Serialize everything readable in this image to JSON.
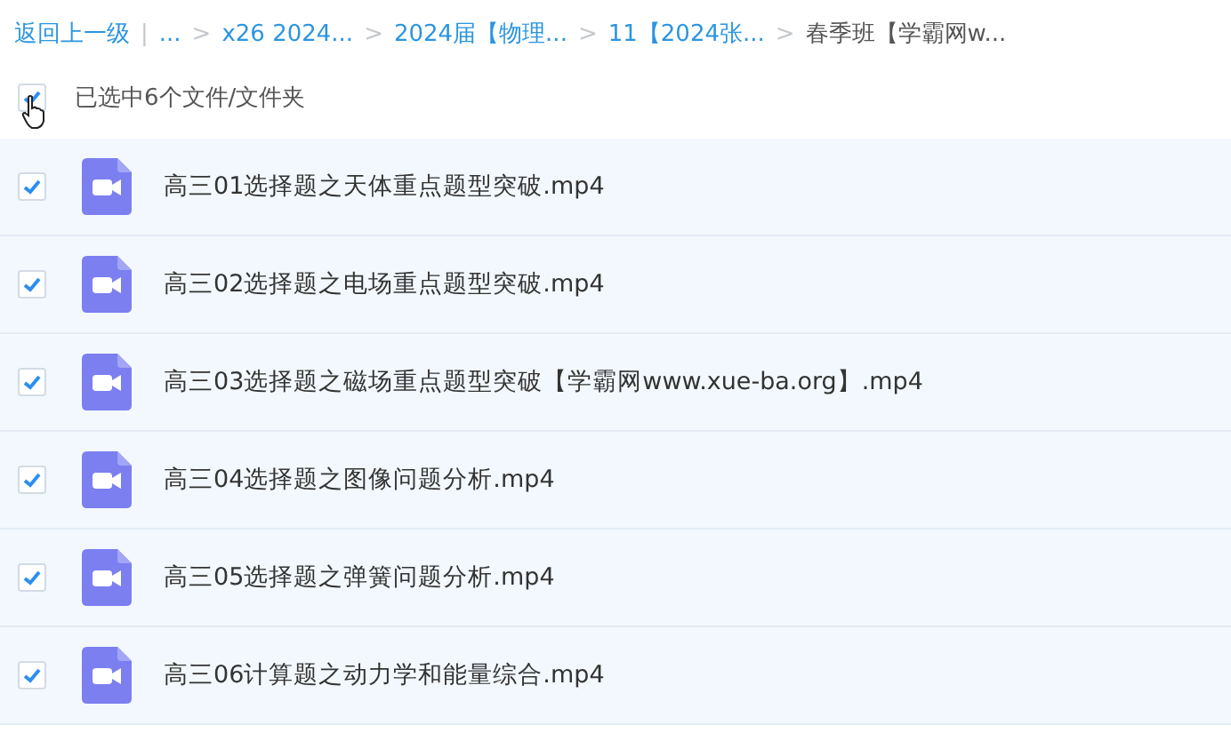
{
  "breadcrumb": [
    {
      "label": "返回上一级",
      "kind": "link"
    },
    {
      "label": "|",
      "kind": "separator"
    },
    {
      "label": "...",
      "kind": "link"
    },
    {
      "label": ">",
      "kind": "separator"
    },
    {
      "label": "x26 2024...",
      "kind": "link"
    },
    {
      "label": ">",
      "kind": "separator"
    },
    {
      "label": "2024届【物理...",
      "kind": "link"
    },
    {
      "label": ">",
      "kind": "separator"
    },
    {
      "label": "11【2024张...",
      "kind": "link"
    },
    {
      "label": ">",
      "kind": "separator"
    },
    {
      "label": "春季班【学霸网w...",
      "kind": "current"
    }
  ],
  "select_all": {
    "label": "已选中6个文件/文件夹",
    "checked": true
  },
  "files": [
    {
      "name": "高三01选择题之天体重点题型突破.mp4",
      "checked": true
    },
    {
      "name": "高三02选择题之电场重点题型突破.mp4",
      "checked": true
    },
    {
      "name": "高三03选择题之磁场重点题型突破【学霸网www.xue-ba.org】.mp4",
      "checked": true
    },
    {
      "name": "高三04选择题之图像问题分析.mp4",
      "checked": true
    },
    {
      "name": "高三05选择题之弹簧问题分析.mp4",
      "checked": true
    },
    {
      "name": "高三06计算题之动力学和能量综合.mp4",
      "checked": true
    }
  ]
}
